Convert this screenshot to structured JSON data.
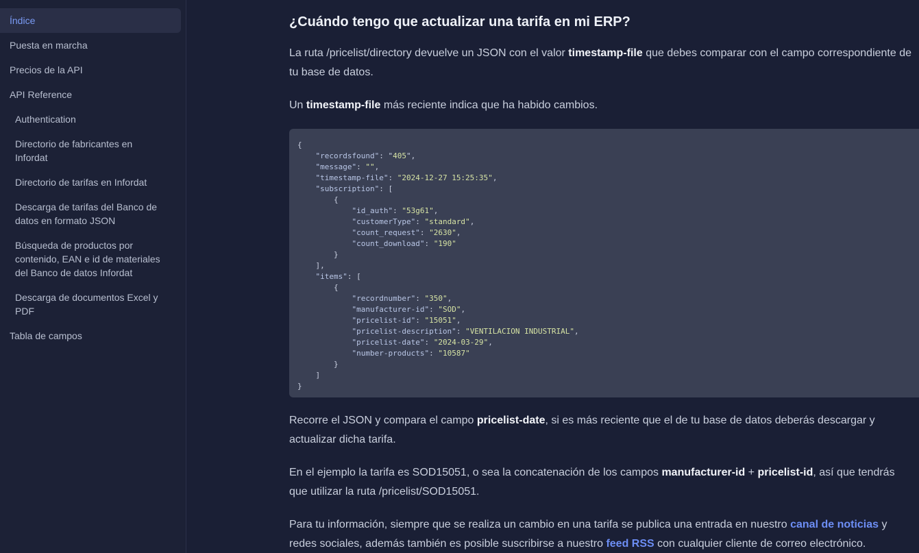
{
  "sidebar": {
    "items": [
      {
        "label": "Índice",
        "active": true
      },
      {
        "label": "Puesta en marcha"
      },
      {
        "label": "Precios de la API"
      },
      {
        "label": "API Reference"
      },
      {
        "label": "Authentication"
      },
      {
        "label": "Directorio de fabricantes en Infordat"
      },
      {
        "label": "Directorio de tarifas en Infordat"
      },
      {
        "label": "Descarga de tarifas del Banco de datos en formato JSON"
      },
      {
        "label": "Búsqueda de productos por contenido, EAN e id de materiales del Banco de datos Infordat"
      },
      {
        "label": "Descarga de documentos Excel y PDF"
      },
      {
        "label": "Tabla de campos"
      }
    ]
  },
  "content": {
    "heading": "¿Cuándo tengo que actualizar una tarifa en mi ERP?",
    "p1": {
      "before": "La ruta /pricelist/directory devuelve un JSON con el valor ",
      "bold": "timestamp-file",
      "after": " que debes comparar con el campo correspondiente de tu base de datos."
    },
    "p2": {
      "before": "Un ",
      "bold": "timestamp-file",
      "after": " más reciente indica que ha habido cambios."
    },
    "code": {
      "recordsfound": "405",
      "message": "",
      "timestamp_file": "2024-12-27 15:25:35",
      "subscription": {
        "id_auth": "53g61",
        "customerType": "standard",
        "count_request": "2630",
        "count_download": "190"
      },
      "items": {
        "recordnumber": "350",
        "manufacturer_id": "SOD",
        "pricelist_id": "15051",
        "pricelist_description": "VENTILACION INDUSTRIAL",
        "pricelist_date": "2024-03-29",
        "number_products": "10587"
      }
    },
    "p3": {
      "before": "Recorre el JSON y compara el campo ",
      "bold": "pricelist-date",
      "after": ", si es más reciente que el de tu base de datos deberás descargar y actualizar dicha tarifa."
    },
    "p4": {
      "before": "En el ejemplo la tarifa es SOD15051, o sea la concatenación de los campos ",
      "bold1": "manufacturer-id",
      "mid": " + ",
      "bold2": "pricelist-id",
      "after": ", así que tendrás que utilizar la ruta /pricelist/SOD15051."
    },
    "p5": {
      "before": "Para tu información, siempre que se realiza un cambio en una tarifa se publica una entrada en nuestro ",
      "link1": "canal de noticias",
      "mid": " y redes sociales, además también es posible suscribirse a nuestro ",
      "link2": "feed RSS",
      "after": " con cualquier cliente de correo electrónico."
    }
  },
  "colors": {
    "background": "#1a1f35",
    "sidebar": "#1c2136",
    "accent": "#7a9bf5",
    "link": "#6d8ef5",
    "code_bg": "#3a4054"
  }
}
